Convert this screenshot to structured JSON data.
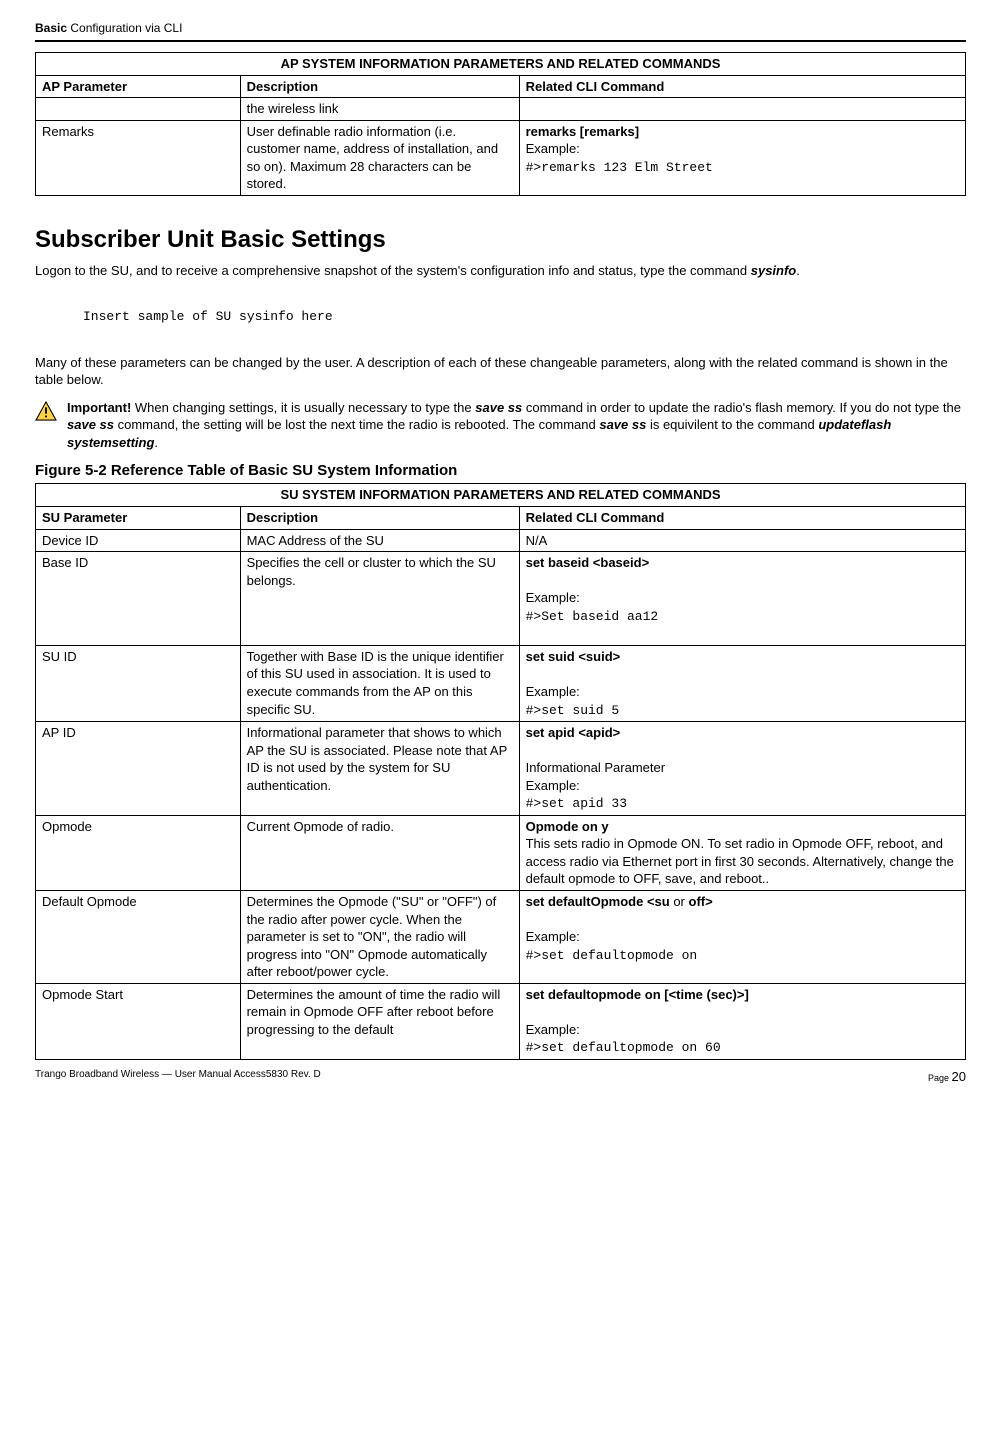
{
  "header": {
    "line": "Basic Configuration via CLI",
    "bold_part": "Basic"
  },
  "ap_table": {
    "title": "AP SYSTEM INFORMATION PARAMETERS AND RELATED COMMANDS",
    "headers": {
      "c1": "AP Parameter",
      "c2": "Description",
      "c3": "Related CLI Command"
    },
    "rows": [
      {
        "c1": "",
        "c2": "the wireless link",
        "c3": ""
      },
      {
        "c1": "Remarks",
        "c2": "User definable radio information (i.e. customer name, address of installation, and so on).  Maximum 28 characters can be stored.",
        "c3_bold": "remarks [remarks]",
        "c3_ex_label": "Example:",
        "c3_mono": "#>remarks 123 Elm Street"
      }
    ]
  },
  "section": {
    "heading": "Subscriber Unit Basic Settings",
    "intro_prefix": "Logon to the SU, and to receive a comprehensive snapshot of the system's configuration info and status, type the command ",
    "intro_cmd": "sysinfo",
    "intro_suffix": "."
  },
  "sample_text": "Insert sample of SU sysinfo here",
  "paragraph_desc": "Many of these parameters can be changed by the user.  A description of each of these changeable parameters, along with the related command is shown in the table below.",
  "important": {
    "label": "Important!",
    "text_a": "  When changing settings, it is usually necessary to type the ",
    "cmd1": "save ss",
    "text_b": " command in order to update the radio's flash memory.  If you do not type the ",
    "cmd2": "save ss",
    "text_c": " command, the setting will be lost the next time the radio is rebooted.  The command ",
    "cmd3": "save ss",
    "text_d": " is equivilent to the command ",
    "cmd4": "updateflash systemsetting",
    "text_e": "."
  },
  "figure_caption": "Figure 5-2 Reference Table of Basic SU System Information",
  "su_table": {
    "title": "SU  SYSTEM INFORMATION PARAMETERS AND RELATED COMMANDS",
    "headers": {
      "c1": "SU Parameter",
      "c2": "Description",
      "c3": "Related CLI Command"
    },
    "rows": [
      {
        "c1": "Device ID",
        "c2": "MAC Address of the SU",
        "c3_plain": "N/A"
      },
      {
        "c1": "Base ID",
        "c2": "Specifies the cell or cluster to which the SU belongs.",
        "c3_bold": "set baseid <baseid>",
        "c3_ex_label": "Example:",
        "c3_mono": "#>Set baseid aa12"
      },
      {
        "c1": "SU ID",
        "c2": "Together with Base ID is the unique identifier of this SU used in association.  It is used to execute commands from the AP on this specific SU.",
        "c3_bold": "set suid <suid>",
        "c3_ex_label": "Example:",
        "c3_mono": "#>set suid 5"
      },
      {
        "c1": "AP ID",
        "c2": "Informational parameter that shows to which AP the SU is associated.  Please note that AP ID is not used by the system for SU authentication.",
        "c3_bold": "set apid <apid>",
        "c3_mid": "Informational Parameter",
        "c3_ex_label": "Example:",
        "c3_mono": "#>set apid 33"
      },
      {
        "c1": "Opmode",
        "c2": "Current Opmode of radio.",
        "c3_bold": "Opmode on y",
        "c3_after": "This sets radio in Opmode ON. To set radio in Opmode OFF, reboot, and access radio via Ethernet port in first 30 seconds.  Alternatively, change the default opmode to OFF, save, and reboot.."
      },
      {
        "c1": "Default Opmode",
        "c2": "Determines the Opmode (\"SU\" or \"OFF\") of the radio after power cycle.  When the parameter is set to \"ON\", the radio will progress into \"ON\" Opmode automatically after reboot/power cycle.",
        "c3_bold_pre": "set defaultOpmode <su ",
        "c3_bold_mid_plain": "or",
        "c3_bold_post": " off>",
        "c3_ex_label": "Example:",
        "c3_mono": "#>set defaultopmode on"
      },
      {
        "c1": "Opmode Start",
        "c2": "Determines the amount of time the radio will remain in Opmode OFF after reboot before progressing to the default",
        "c3_bold": "set defaultopmode on [<time (sec)>]",
        "c3_ex_label": "Example:",
        "c3_mono": "#>set defaultopmode on 60"
      }
    ]
  },
  "footer": {
    "left": "Trango Broadband Wireless — User Manual Access5830  Rev. D",
    "right_label": "Page ",
    "right_num": "20"
  }
}
